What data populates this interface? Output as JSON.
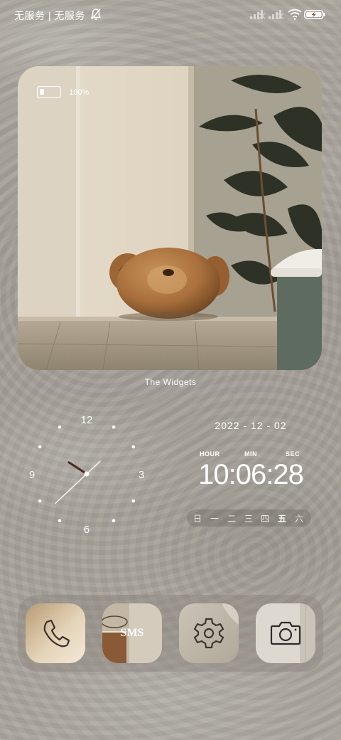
{
  "status_bar": {
    "carrier": "无服务 | 无服务",
    "icons": [
      "bell-off-icon",
      "signal-icon",
      "signal-icon",
      "wifi-icon",
      "battery-charging-icon"
    ]
  },
  "photo_widget": {
    "battery_percent": "100%",
    "battery_level": 1.0,
    "label": "The Widgets"
  },
  "analog_clock": {
    "numerals": [
      "12",
      "3",
      "6",
      "9"
    ],
    "hour": 10,
    "minute": 6
  },
  "digital_clock": {
    "date": "2022 - 12 - 02",
    "unit_hour": "HOUR",
    "unit_min": "MIN",
    "unit_sec": "SEC",
    "time": "10:06:28",
    "weekdays": [
      "日",
      "一",
      "二",
      "三",
      "四",
      "五",
      "六"
    ],
    "active_weekday": "五"
  },
  "dock": {
    "apps": [
      {
        "name": "phone",
        "icon": "phone-icon"
      },
      {
        "name": "sms",
        "label": "SMS"
      },
      {
        "name": "settings",
        "icon": "gear-icon"
      },
      {
        "name": "camera",
        "icon": "camera-icon"
      }
    ]
  },
  "colors": {
    "wallpaper": "#a7a29b",
    "text": "#ffffff",
    "clock_hour_hand": "#4a2a1a"
  }
}
